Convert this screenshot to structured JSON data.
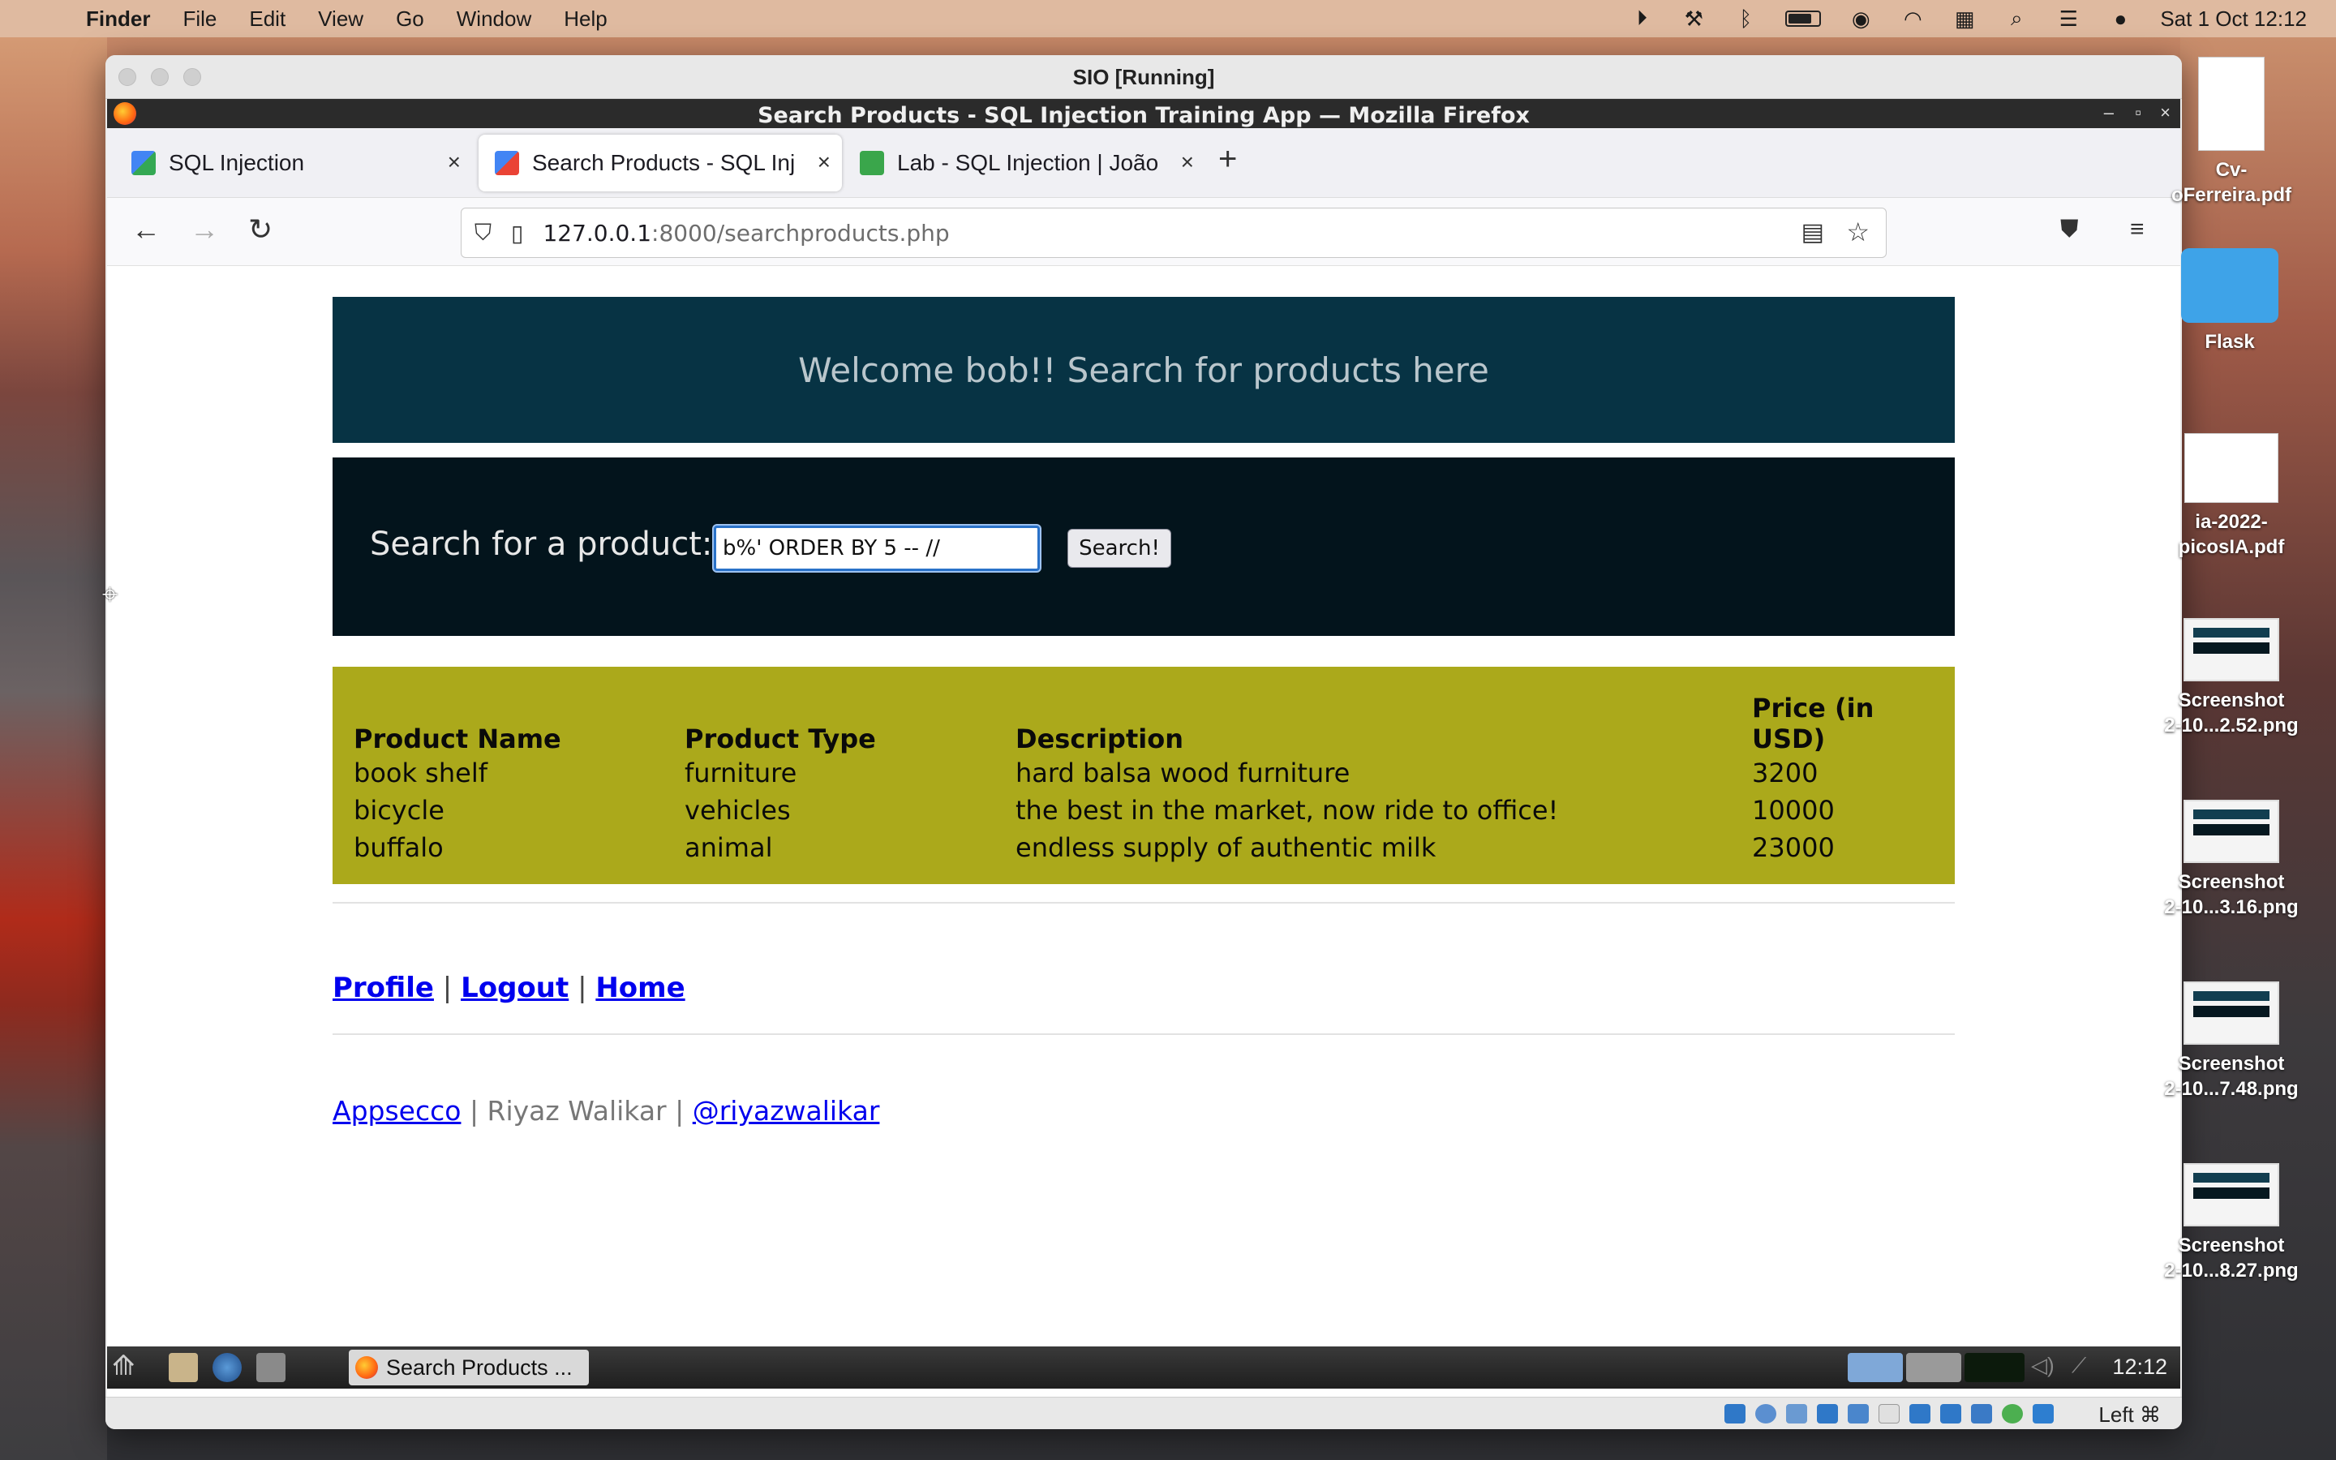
{
  "menubar": {
    "app_name": "Finder",
    "menus": [
      "File",
      "Edit",
      "View",
      "Go",
      "Window",
      "Help"
    ],
    "clock": "Sat 1 Oct  12:12"
  },
  "vbox": {
    "title": "SIO [Running]",
    "host_key": "Left ⌘"
  },
  "firefox": {
    "window_title": "Search Products - SQL Injection Training App — Mozilla Firefox",
    "tabs": [
      {
        "label": "SQL Injection"
      },
      {
        "label": "Search Products - SQL Inj"
      },
      {
        "label": "Lab - SQL Injection | João"
      }
    ],
    "url_host": "127.0.0.1",
    "url_rest": ":8000/searchproducts.php"
  },
  "page": {
    "banner": "Welcome bob!! Search for products here",
    "search_label": "Search for a product:",
    "search_value": "b%' ORDER BY 5 -- //",
    "search_button": "Search!",
    "table": {
      "headers": [
        "Product Name",
        "Product Type",
        "Description",
        "Price (in USD)"
      ],
      "rows": [
        [
          "book shelf",
          "furniture",
          "hard balsa wood furniture",
          "3200"
        ],
        [
          "bicycle",
          "vehicles",
          "the best in the market, now ride to office!",
          "10000"
        ],
        [
          "buffalo",
          "animal",
          "endless supply of authentic milk",
          "23000"
        ]
      ]
    },
    "links": {
      "profile": "Profile",
      "logout": "Logout",
      "home": "Home",
      "sep": "|"
    },
    "footer": {
      "appsecco": "Appsecco",
      "author": " | Riyaz Walikar | ",
      "twitter": "@riyazwalikar"
    }
  },
  "taskbar": {
    "task_label": "Search Products ...",
    "clock": "12:12"
  },
  "desktop": {
    "items": [
      {
        "label": "Cv-\noFerreira.pdf"
      },
      {
        "label": "Flask"
      },
      {
        "label": "ia-2022-\npicosIA.pdf"
      },
      {
        "label": "Screenshot\n2-10...2.52.png"
      },
      {
        "label": "Screenshot\n2-10...3.16.png"
      },
      {
        "label": "Screenshot\n2-10...7.48.png"
      },
      {
        "label": "Screenshot\n2-10...8.27.png"
      }
    ]
  }
}
